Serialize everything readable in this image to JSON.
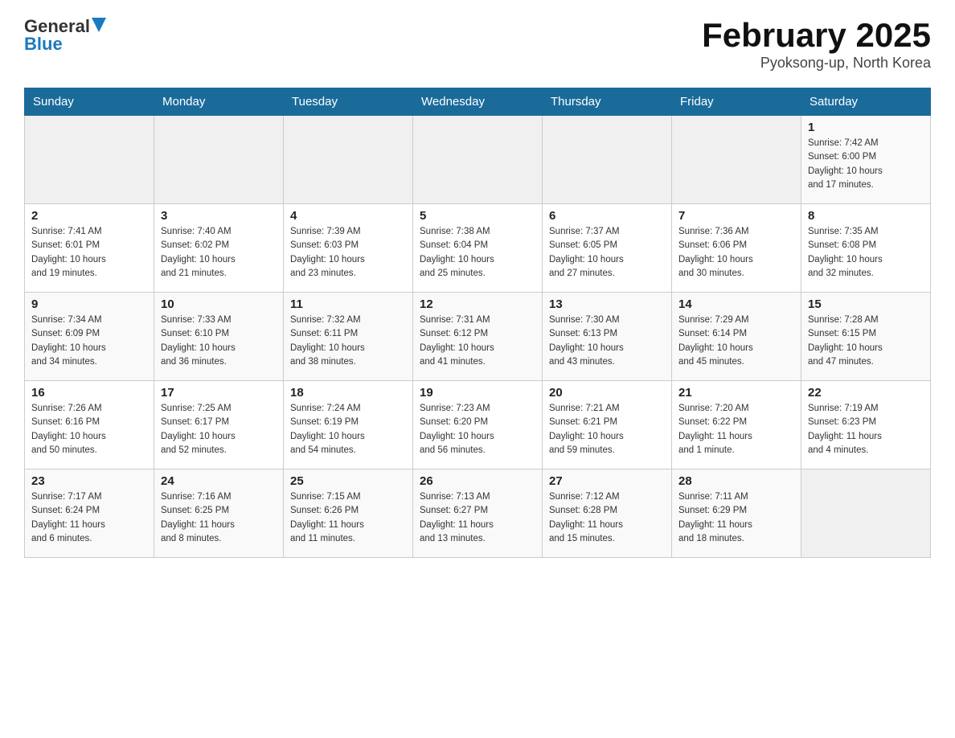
{
  "header": {
    "logo_general": "General",
    "logo_blue": "Blue",
    "month_title": "February 2025",
    "location": "Pyoksong-up, North Korea"
  },
  "days_of_week": [
    "Sunday",
    "Monday",
    "Tuesday",
    "Wednesday",
    "Thursday",
    "Friday",
    "Saturday"
  ],
  "weeks": [
    [
      {
        "day": "",
        "info": ""
      },
      {
        "day": "",
        "info": ""
      },
      {
        "day": "",
        "info": ""
      },
      {
        "day": "",
        "info": ""
      },
      {
        "day": "",
        "info": ""
      },
      {
        "day": "",
        "info": ""
      },
      {
        "day": "1",
        "info": "Sunrise: 7:42 AM\nSunset: 6:00 PM\nDaylight: 10 hours\nand 17 minutes."
      }
    ],
    [
      {
        "day": "2",
        "info": "Sunrise: 7:41 AM\nSunset: 6:01 PM\nDaylight: 10 hours\nand 19 minutes."
      },
      {
        "day": "3",
        "info": "Sunrise: 7:40 AM\nSunset: 6:02 PM\nDaylight: 10 hours\nand 21 minutes."
      },
      {
        "day": "4",
        "info": "Sunrise: 7:39 AM\nSunset: 6:03 PM\nDaylight: 10 hours\nand 23 minutes."
      },
      {
        "day": "5",
        "info": "Sunrise: 7:38 AM\nSunset: 6:04 PM\nDaylight: 10 hours\nand 25 minutes."
      },
      {
        "day": "6",
        "info": "Sunrise: 7:37 AM\nSunset: 6:05 PM\nDaylight: 10 hours\nand 27 minutes."
      },
      {
        "day": "7",
        "info": "Sunrise: 7:36 AM\nSunset: 6:06 PM\nDaylight: 10 hours\nand 30 minutes."
      },
      {
        "day": "8",
        "info": "Sunrise: 7:35 AM\nSunset: 6:08 PM\nDaylight: 10 hours\nand 32 minutes."
      }
    ],
    [
      {
        "day": "9",
        "info": "Sunrise: 7:34 AM\nSunset: 6:09 PM\nDaylight: 10 hours\nand 34 minutes."
      },
      {
        "day": "10",
        "info": "Sunrise: 7:33 AM\nSunset: 6:10 PM\nDaylight: 10 hours\nand 36 minutes."
      },
      {
        "day": "11",
        "info": "Sunrise: 7:32 AM\nSunset: 6:11 PM\nDaylight: 10 hours\nand 38 minutes."
      },
      {
        "day": "12",
        "info": "Sunrise: 7:31 AM\nSunset: 6:12 PM\nDaylight: 10 hours\nand 41 minutes."
      },
      {
        "day": "13",
        "info": "Sunrise: 7:30 AM\nSunset: 6:13 PM\nDaylight: 10 hours\nand 43 minutes."
      },
      {
        "day": "14",
        "info": "Sunrise: 7:29 AM\nSunset: 6:14 PM\nDaylight: 10 hours\nand 45 minutes."
      },
      {
        "day": "15",
        "info": "Sunrise: 7:28 AM\nSunset: 6:15 PM\nDaylight: 10 hours\nand 47 minutes."
      }
    ],
    [
      {
        "day": "16",
        "info": "Sunrise: 7:26 AM\nSunset: 6:16 PM\nDaylight: 10 hours\nand 50 minutes."
      },
      {
        "day": "17",
        "info": "Sunrise: 7:25 AM\nSunset: 6:17 PM\nDaylight: 10 hours\nand 52 minutes."
      },
      {
        "day": "18",
        "info": "Sunrise: 7:24 AM\nSunset: 6:19 PM\nDaylight: 10 hours\nand 54 minutes."
      },
      {
        "day": "19",
        "info": "Sunrise: 7:23 AM\nSunset: 6:20 PM\nDaylight: 10 hours\nand 56 minutes."
      },
      {
        "day": "20",
        "info": "Sunrise: 7:21 AM\nSunset: 6:21 PM\nDaylight: 10 hours\nand 59 minutes."
      },
      {
        "day": "21",
        "info": "Sunrise: 7:20 AM\nSunset: 6:22 PM\nDaylight: 11 hours\nand 1 minute."
      },
      {
        "day": "22",
        "info": "Sunrise: 7:19 AM\nSunset: 6:23 PM\nDaylight: 11 hours\nand 4 minutes."
      }
    ],
    [
      {
        "day": "23",
        "info": "Sunrise: 7:17 AM\nSunset: 6:24 PM\nDaylight: 11 hours\nand 6 minutes."
      },
      {
        "day": "24",
        "info": "Sunrise: 7:16 AM\nSunset: 6:25 PM\nDaylight: 11 hours\nand 8 minutes."
      },
      {
        "day": "25",
        "info": "Sunrise: 7:15 AM\nSunset: 6:26 PM\nDaylight: 11 hours\nand 11 minutes."
      },
      {
        "day": "26",
        "info": "Sunrise: 7:13 AM\nSunset: 6:27 PM\nDaylight: 11 hours\nand 13 minutes."
      },
      {
        "day": "27",
        "info": "Sunrise: 7:12 AM\nSunset: 6:28 PM\nDaylight: 11 hours\nand 15 minutes."
      },
      {
        "day": "28",
        "info": "Sunrise: 7:11 AM\nSunset: 6:29 PM\nDaylight: 11 hours\nand 18 minutes."
      },
      {
        "day": "",
        "info": ""
      }
    ]
  ]
}
